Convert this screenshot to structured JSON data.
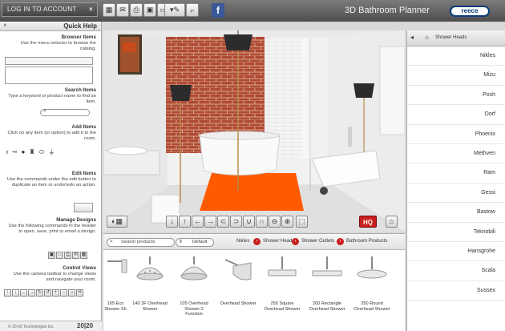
{
  "app": {
    "login_label": "LOG IN TO ACCOUNT",
    "title": "3D Bathroom Planner",
    "brand_logo": "reece",
    "facebook_glyph": "f"
  },
  "toolbar": {
    "icons": [
      "new-icon",
      "open-icon",
      "save-icon",
      "email-icon",
      "print-icon",
      "measure-icon",
      "undo-icon",
      "redo-icon",
      "facebook-icon"
    ]
  },
  "help": {
    "title": "Quick Help",
    "close_glyph": "×",
    "sections": [
      {
        "heading": "Browser Items",
        "text": "Use the menu selector to browse the catalog."
      },
      {
        "heading": "Search Items",
        "text": "Type a keyword or product name to find an item."
      },
      {
        "heading": "Add Items",
        "text": "Click on any item (or option) to add it to the room."
      },
      {
        "heading": "Edit Items",
        "text": "Use the commands under the edit button to duplicate an item or undo/redo an action."
      },
      {
        "heading": "Manage Designs",
        "text": "Use the following commands in the header to open, save, print or email a design."
      },
      {
        "heading": "Control Views",
        "text": "Use the camera toolbar to change views and navigate your room."
      }
    ],
    "footer_tech": "© 20-20 Technologies Inc.",
    "footer_logo": "20|20"
  },
  "brands": {
    "breadcrumb": "Shower Heads",
    "items": [
      "Nikles",
      "Mizu",
      "Posh",
      "Dorf",
      "Phoenix",
      "Methven",
      "Ram",
      "Gessi",
      "Bastow",
      "Teknobili",
      "Hansgrohe",
      "Scala",
      "Sussex"
    ]
  },
  "view_toolbar": {
    "hq_label": "HQ",
    "buttons": [
      "home-icon",
      "zoom-in-icon",
      "zoom-out-icon",
      "rotate-left-icon",
      "rotate-right-icon",
      "tilt-up-icon",
      "tilt-down-icon",
      "left-icon",
      "right-icon",
      "forward-icon",
      "back-icon"
    ]
  },
  "products": {
    "search_placeholder": "Search products",
    "sort_label": "Default",
    "breadcrumbs": [
      "Bathroom Products",
      "Shower Outlets",
      "Shower Heads",
      "Nikles"
    ],
    "items": [
      {
        "label": "250 Round Overhead Shower"
      },
      {
        "label": "200 Rectangle Overhead Shower"
      },
      {
        "label": "250 Square Overhead Shower"
      },
      {
        "label": "Overhead Shower"
      },
      {
        "label": "105 Overhead Shower 2 Function"
      },
      {
        "label": "140 3F Overhead Shower"
      },
      {
        "label": "105 Eco Shower Sh"
      }
    ]
  },
  "colors": {
    "brick": "#b5452f",
    "rug": "#ff5a00",
    "accent_red": "#c81e1e"
  }
}
